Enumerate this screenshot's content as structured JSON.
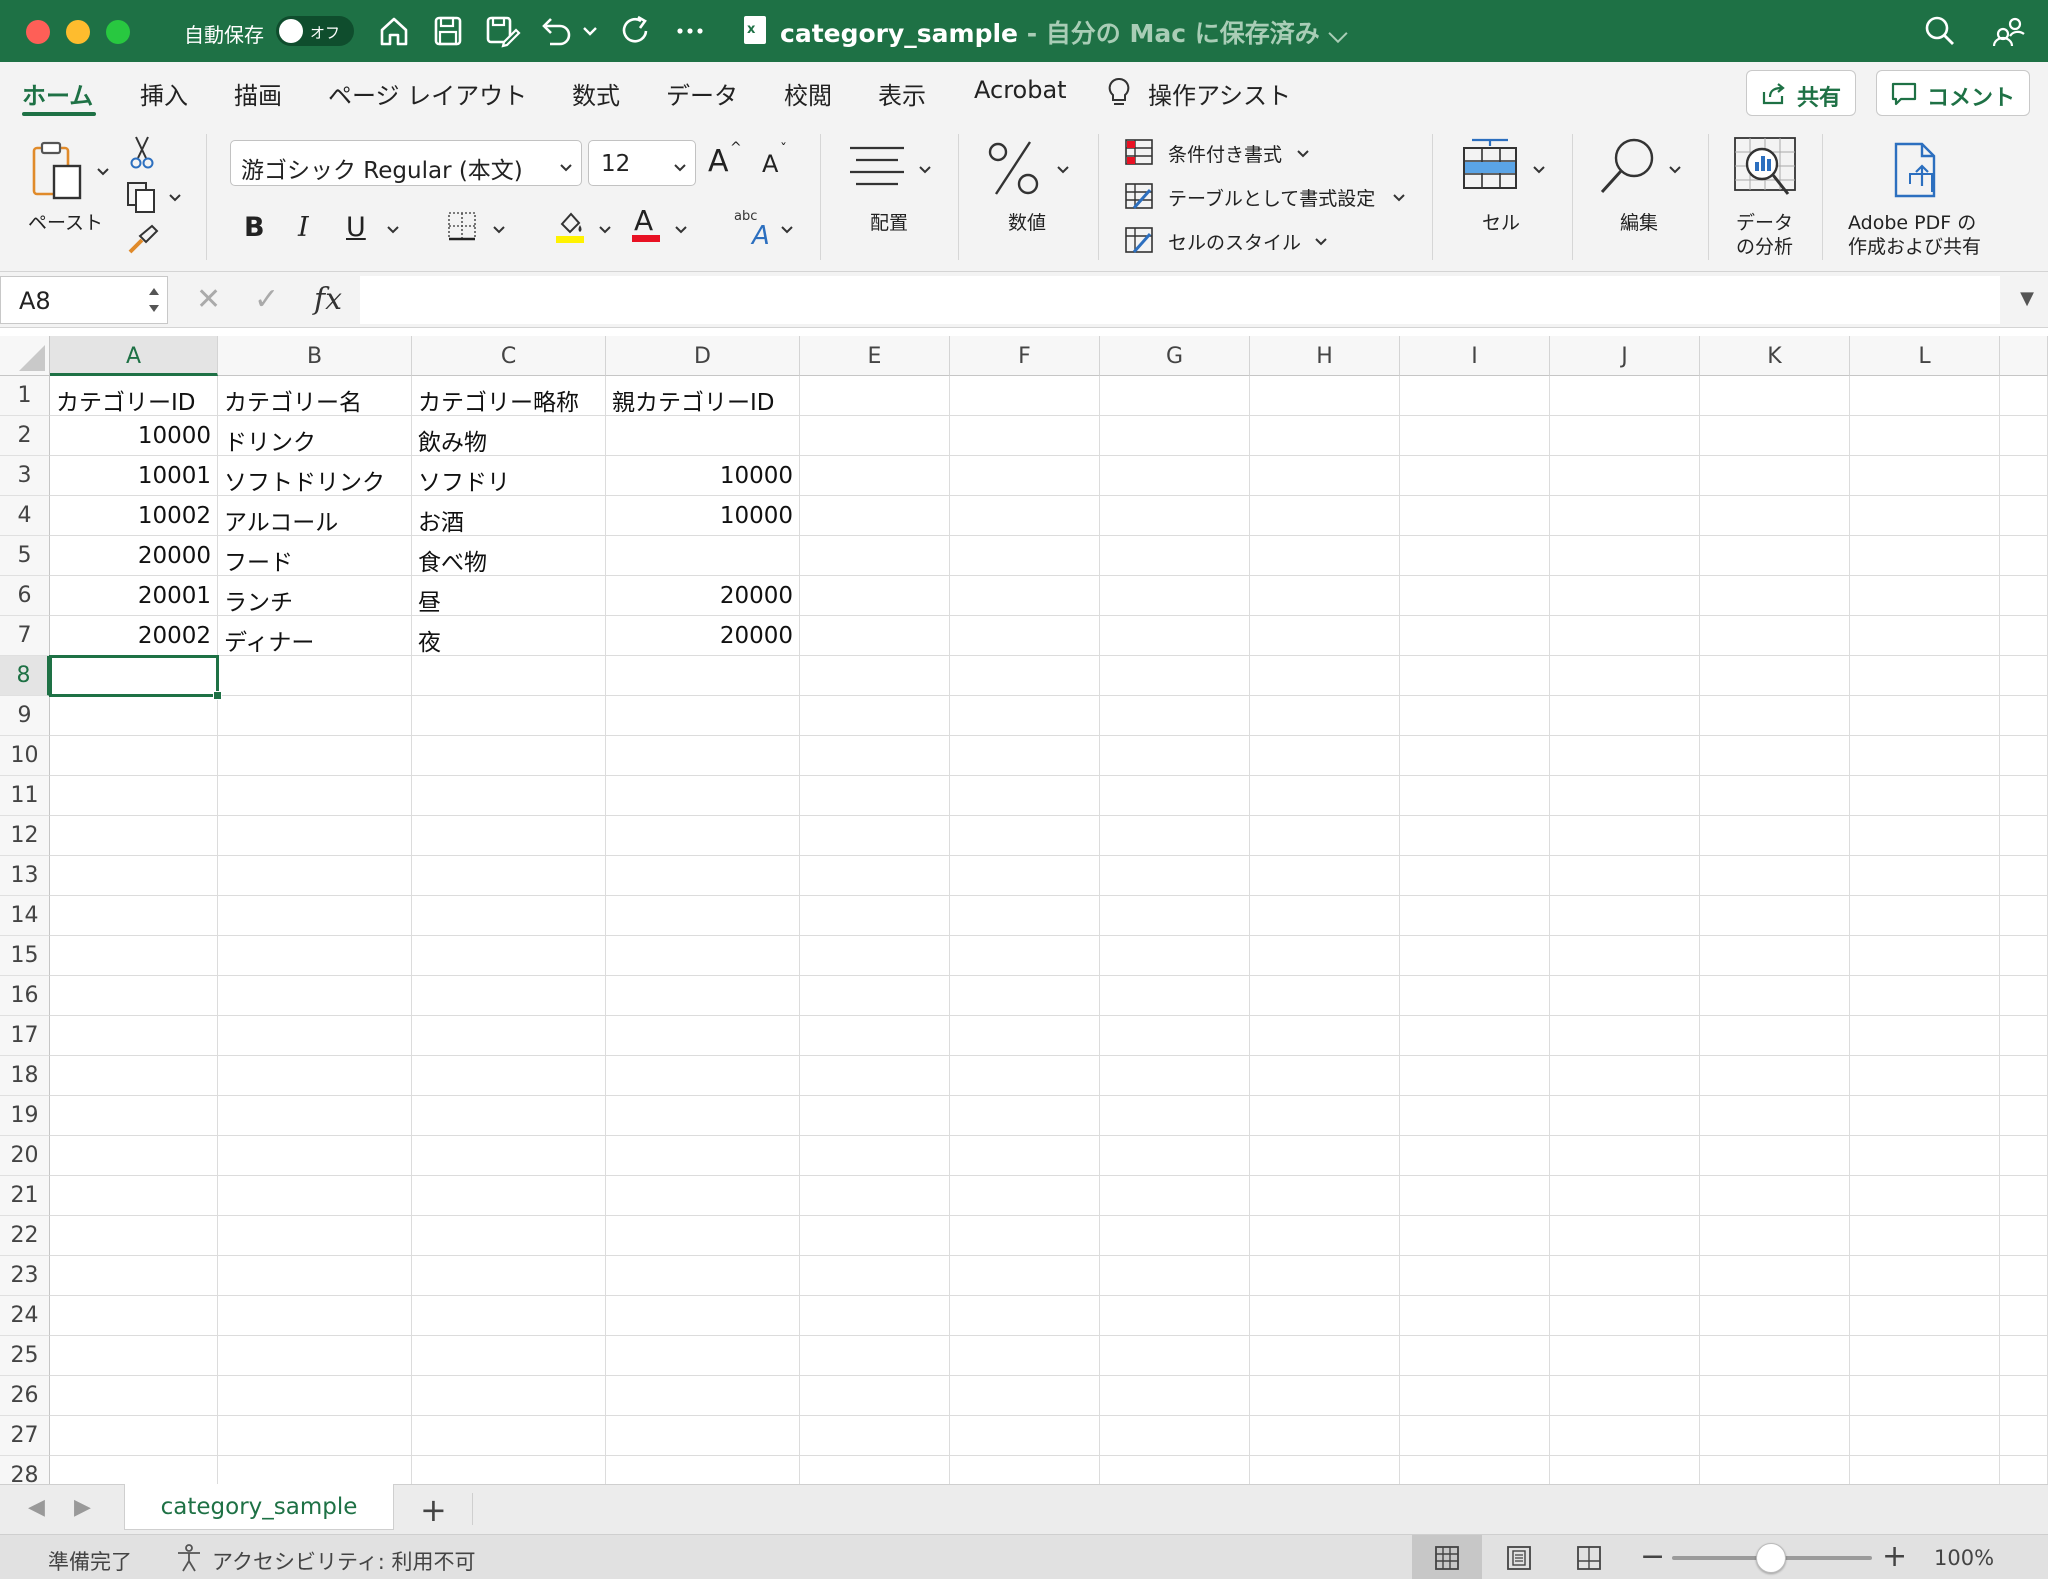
{
  "titlebar": {
    "autosave_label": "自動保存",
    "toggle_label": "オフ",
    "file_name": "category_sample",
    "save_status": " - 自分の Mac に保存済み ⌵"
  },
  "tabs": {
    "items": [
      "ホーム",
      "挿入",
      "描画",
      "ページ レイアウト",
      "数式",
      "データ",
      "校閲",
      "表示",
      "Acrobat",
      "操作アシスト"
    ],
    "active": "ホーム",
    "share": "共有",
    "comment": "コメント"
  },
  "ribbon": {
    "paste": "ペースト",
    "font_name": "游ゴシック Regular (本文)",
    "font_size": "12",
    "bold": "B",
    "italic": "I",
    "underline": "U",
    "grow": "A",
    "shrink": "A",
    "font_color": "A",
    "alignment": "配置",
    "number": "数値",
    "conditional_format": "条件付き書式",
    "format_as_table": "テーブルとして書式設定",
    "cell_styles": "セルのスタイル",
    "cells": "セル",
    "editing": "編集",
    "analyze_line1": "データ",
    "analyze_line2": "の分析",
    "adobe_line1": "Adobe PDF の",
    "adobe_line2": "作成および共有"
  },
  "formula_bar": {
    "name_box": "A8",
    "formula": ""
  },
  "sheet": {
    "columns": [
      "A",
      "B",
      "C",
      "D",
      "E",
      "F",
      "G",
      "H",
      "I",
      "J",
      "K",
      "L"
    ],
    "selected_column": "A",
    "selected_row": "8",
    "rows": [
      "1",
      "2",
      "3",
      "4",
      "5",
      "6",
      "7",
      "8",
      "9",
      "10",
      "11",
      "12",
      "13",
      "14",
      "15",
      "16",
      "17",
      "18",
      "19",
      "20",
      "21",
      "22",
      "23",
      "24",
      "25",
      "26",
      "27",
      "28"
    ],
    "data": [
      [
        "カテゴリーID",
        "カテゴリー名",
        "カテゴリー略称",
        "親カテゴリーID"
      ],
      [
        "10000",
        "ドリンク",
        "飲み物",
        ""
      ],
      [
        "10001",
        "ソフトドリンク",
        "ソフドリ",
        "10000"
      ],
      [
        "10002",
        "アルコール",
        "お酒",
        "10000"
      ],
      [
        "20000",
        "フード",
        "食べ物",
        ""
      ],
      [
        "20001",
        "ランチ",
        "昼",
        "20000"
      ],
      [
        "20002",
        "ディナー",
        "夜",
        "20000"
      ]
    ]
  },
  "sheet_tabs": {
    "active": "category_sample",
    "add": "+"
  },
  "statusbar": {
    "ready": "準備完了",
    "accessibility": "アクセシビリティ: 利用不可",
    "zoom": "100%",
    "zoom_level": 1.0
  }
}
